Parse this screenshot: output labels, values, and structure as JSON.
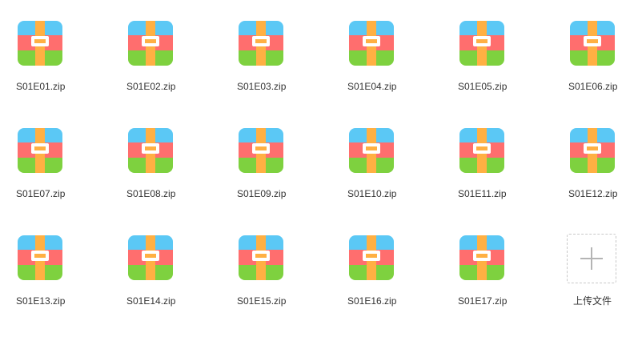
{
  "files": [
    {
      "name": "S01E01.zip",
      "icon": "zip-archive-icon"
    },
    {
      "name": "S01E02.zip",
      "icon": "zip-archive-icon"
    },
    {
      "name": "S01E03.zip",
      "icon": "zip-archive-icon"
    },
    {
      "name": "S01E04.zip",
      "icon": "zip-archive-icon"
    },
    {
      "name": "S01E05.zip",
      "icon": "zip-archive-icon"
    },
    {
      "name": "S01E06.zip",
      "icon": "zip-archive-icon"
    },
    {
      "name": "S01E07.zip",
      "icon": "zip-archive-icon"
    },
    {
      "name": "S01E08.zip",
      "icon": "zip-archive-icon"
    },
    {
      "name": "S01E09.zip",
      "icon": "zip-archive-icon"
    },
    {
      "name": "S01E10.zip",
      "icon": "zip-archive-icon"
    },
    {
      "name": "S01E11.zip",
      "icon": "zip-archive-icon"
    },
    {
      "name": "S01E12.zip",
      "icon": "zip-archive-icon"
    },
    {
      "name": "S01E13.zip",
      "icon": "zip-archive-icon"
    },
    {
      "name": "S01E14.zip",
      "icon": "zip-archive-icon"
    },
    {
      "name": "S01E15.zip",
      "icon": "zip-archive-icon"
    },
    {
      "name": "S01E16.zip",
      "icon": "zip-archive-icon"
    },
    {
      "name": "S01E17.zip",
      "icon": "zip-archive-icon"
    }
  ],
  "upload": {
    "label": "上传文件",
    "icon": "plus-icon"
  },
  "colors": {
    "icon_top": "#5bc8f5",
    "icon_middle": "#ff6e6e",
    "icon_bottom": "#7ed13f",
    "icon_strap": "#ffb043",
    "label_text": "#333333"
  }
}
